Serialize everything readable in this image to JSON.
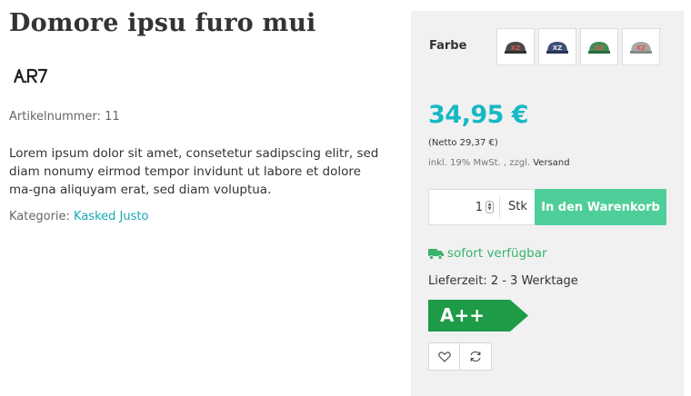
{
  "product": {
    "title": "Domore ipsu furo mui",
    "brand_logo_text": "A.R7",
    "sku_label": "Artikelnummer:",
    "sku_value": "11",
    "description": "Lorem ipsum dolor sit amet, consetetur sadipscing elitr, sed diam nonumy eirmod tempor invidunt ut labore et dolore ma-gna aliquyam erat, sed diam voluptua.",
    "category_label": "Kategorie:",
    "category_link": "Kasked Justo"
  },
  "variants": {
    "label": "Farbe",
    "swatches": [
      {
        "name": "cap-dark",
        "color": "#4a4a4a",
        "accent": "#d9534f"
      },
      {
        "name": "cap-navy",
        "color": "#2c3e66",
        "accent": "#d9534f"
      },
      {
        "name": "cap-green",
        "color": "#2f7d4a",
        "accent": "#d9534f"
      },
      {
        "name": "cap-grey",
        "color": "#9a9a9a",
        "accent": "#d9534f"
      }
    ]
  },
  "pricing": {
    "price": "34,95 €",
    "netto": "(Netto 29,37 €)",
    "tax_text": "inkl. 19% MwSt. , zzgl.",
    "shipping_link": "Versand"
  },
  "buy": {
    "quantity": "1",
    "unit": "Stk",
    "button_label": "In den Warenkorb"
  },
  "availability": {
    "status": "sofort verfügbar",
    "delivery_time": "Lieferzeit: 2 - 3 Werktage"
  },
  "energy": {
    "label": "A++",
    "color": "#1e9b47"
  },
  "actions": {
    "wishlist_icon": "heart-icon",
    "compare_icon": "refresh-icon"
  },
  "colors": {
    "accent": "#17b8c4",
    "button": "#4ecf9a",
    "available": "#37b36a",
    "panel_bg": "#f1f1f1"
  }
}
